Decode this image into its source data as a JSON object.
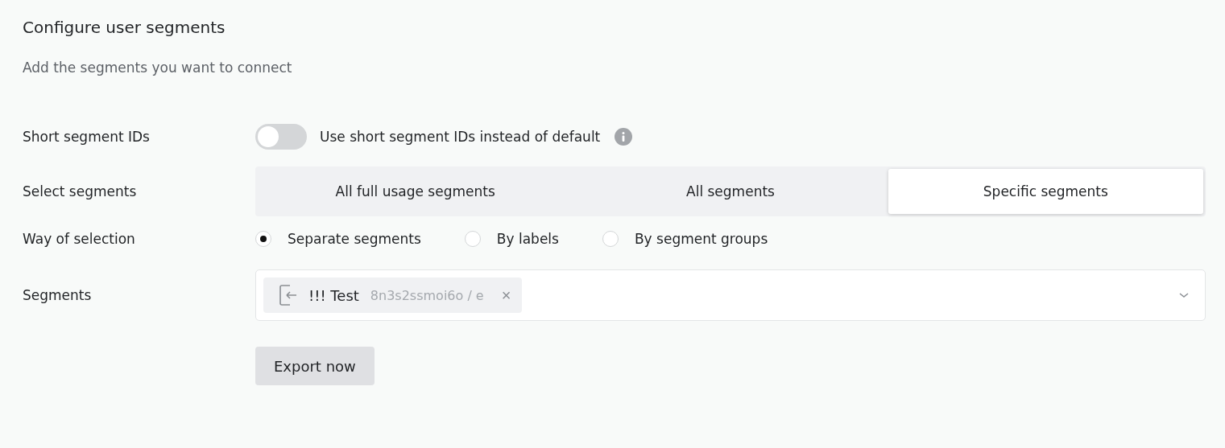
{
  "title": "Configure user segments",
  "subtitle": "Add the segments you want to connect",
  "short_ids": {
    "label": "Short segment IDs",
    "toggle_text": "Use short segment IDs instead of default",
    "on": false
  },
  "select_segments": {
    "label": "Select segments",
    "options": [
      {
        "label": "All full usage segments",
        "selected": false
      },
      {
        "label": "All segments",
        "selected": false
      },
      {
        "label": "Specific segments",
        "selected": true
      }
    ]
  },
  "way_of_selection": {
    "label": "Way of selection",
    "options": [
      {
        "label": "Separate segments",
        "selected": true
      },
      {
        "label": "By labels",
        "selected": false
      },
      {
        "label": "By segment groups",
        "selected": false
      }
    ]
  },
  "segments": {
    "label": "Segments",
    "chips": [
      {
        "name": "!!! Test",
        "id": "8n3s2ssmoi6o / e",
        "close": "×"
      }
    ]
  },
  "export_button": "Export now"
}
